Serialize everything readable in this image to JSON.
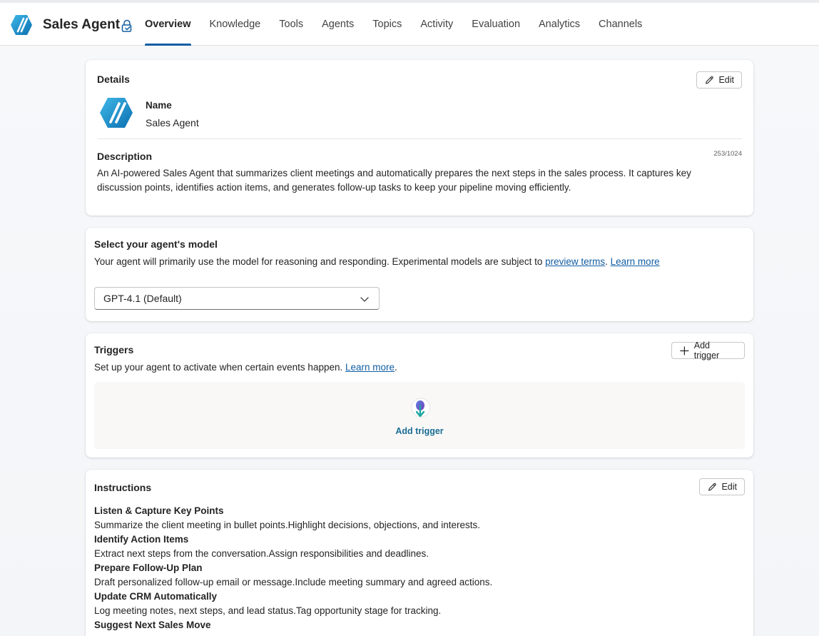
{
  "header": {
    "app_name": "Sales Agent",
    "tabs": [
      "Overview",
      "Knowledge",
      "Tools",
      "Agents",
      "Topics",
      "Activity",
      "Evaluation",
      "Analytics",
      "Channels"
    ],
    "active_tab": "Overview"
  },
  "details": {
    "title": "Details",
    "edit_label": "Edit",
    "name_label": "Name",
    "name_value": "Sales Agent",
    "description_label": "Description",
    "char_count": "253/1024",
    "description": "An AI-powered Sales Agent that summarizes client meetings and automatically prepares the next steps in the sales process. It captures key discussion points, identifies action items, and generates follow-up tasks to keep your pipeline moving efficiently."
  },
  "model": {
    "title": "Select your agent's model",
    "desc_prefix": "Your agent will primarily use the model for reasoning and responding. Experimental models are subject to ",
    "preview_link": "preview terms",
    "separator": ". ",
    "learn_more": "Learn more",
    "selected": "GPT-4.1 (Default)"
  },
  "triggers": {
    "title": "Triggers",
    "add_button": "Add trigger",
    "desc_prefix": "Set up your agent to activate when certain events happen. ",
    "learn_more": "Learn more",
    "desc_suffix": ".",
    "empty_action": "Add trigger"
  },
  "instructions": {
    "title": "Instructions",
    "edit_label": "Edit",
    "items": [
      {
        "heading": "Listen & Capture Key Points",
        "text": "Summarize the client meeting in bullet points.Highlight decisions, objections, and interests."
      },
      {
        "heading": "Identify Action Items",
        "text": "Extract next steps from the conversation.Assign responsibilities and deadlines."
      },
      {
        "heading": "Prepare Follow-Up Plan",
        "text": "Draft personalized follow-up email or message.Include meeting summary and agreed actions."
      },
      {
        "heading": "Update CRM Automatically",
        "text": "Log meeting notes, next steps, and lead status.Tag opportunity stage for tracking."
      },
      {
        "heading": "Suggest Next Sales Move",
        "text": ""
      }
    ]
  },
  "colors": {
    "accent": "#115ea3",
    "logo_blue": "#1e9bd7"
  }
}
